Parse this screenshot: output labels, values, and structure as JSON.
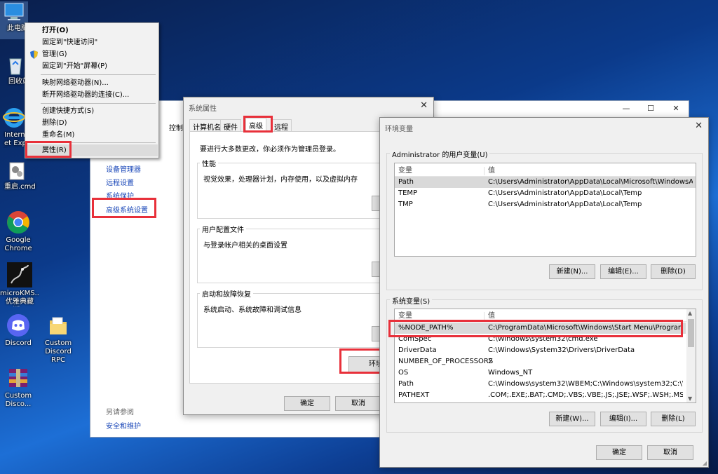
{
  "desktop_icons": [
    {
      "label": "此电脑",
      "icon": "computer-icon"
    },
    {
      "label": "回收站",
      "icon": "recycle-bin-icon"
    },
    {
      "label": "Internet Explorer",
      "icon": "ie-icon"
    },
    {
      "label": "重启.cmd",
      "icon": "cmd-file-icon"
    },
    {
      "label": "Google Chrome",
      "icon": "chrome-icon"
    },
    {
      "label": "microKMS...优雅典藏版...",
      "icon": "dragon-icon"
    },
    {
      "label": "Discord",
      "icon": "discord-icon"
    },
    {
      "label": "Custom Discord RPC",
      "icon": "folder-icon"
    },
    {
      "label": "Custom Disco...",
      "icon": "winrar-icon"
    }
  ],
  "context_menu": {
    "items": [
      {
        "label": "打开(O)",
        "bold": true
      },
      {
        "label": "固定到\"快速访问\""
      },
      {
        "label": "管理(G)",
        "icon": "shield-icon"
      },
      {
        "label": "固定到\"开始\"屏幕(P)"
      },
      {
        "label": "映射网络驱动器(N)..."
      },
      {
        "label": "断开网络驱动器的连接(C)..."
      },
      {
        "label": "创建快捷方式(S)"
      },
      {
        "label": "删除(D)"
      },
      {
        "label": "重命名(M)"
      },
      {
        "label": "属性(R)"
      }
    ]
  },
  "control_panel": {
    "breadcrumb_fragment": "控制",
    "side_links": [
      "设备管理器",
      "远程设置",
      "系统保护",
      "高级系统设置"
    ],
    "see_also": "另请参阅",
    "security_link": "安全和维护"
  },
  "system_properties": {
    "title": "系统属性",
    "tabs": [
      "计算机名",
      "硬件",
      "高级",
      "远程"
    ],
    "active_tab": "高级",
    "admin_note": "要进行大多数更改，你必须作为管理员登录。",
    "groups": [
      {
        "label": "性能",
        "desc": "视觉效果，处理器计划，内存使用，以及虚拟内存"
      },
      {
        "label": "用户配置文件",
        "desc": "与登录帐户相关的桌面设置"
      },
      {
        "label": "启动和故障恢复",
        "desc": "系统启动、系统故障和调试信息"
      }
    ],
    "env_button": "环境变",
    "ok": "确定",
    "cancel": "取消"
  },
  "env_vars": {
    "title": "环境变量",
    "user_section": "Administrator 的用户变量(U)",
    "system_section": "系统变量(S)",
    "col_var": "变量",
    "col_val": "值",
    "user_rows": [
      {
        "name": "Path",
        "value": "C:\\Users\\Administrator\\AppData\\Local\\Microsoft\\WindowsA..."
      },
      {
        "name": "TEMP",
        "value": "C:\\Users\\Administrator\\AppData\\Local\\Temp"
      },
      {
        "name": "TMP",
        "value": "C:\\Users\\Administrator\\AppData\\Local\\Temp"
      }
    ],
    "system_rows": [
      {
        "name": "%NODE_PATH%",
        "value": "C:\\ProgramData\\Microsoft\\Windows\\Start Menu\\Programs"
      },
      {
        "name": "ComSpec",
        "value": "C:\\Windows\\system32\\cmd.exe"
      },
      {
        "name": "DriverData",
        "value": "C:\\Windows\\System32\\Drivers\\DriverData"
      },
      {
        "name": "NUMBER_OF_PROCESSORS",
        "value": "2"
      },
      {
        "name": "OS",
        "value": "Windows_NT"
      },
      {
        "name": "Path",
        "value": "C:\\Windows\\system32\\WBEM;C:\\Windows\\system32;C:\\Wind..."
      },
      {
        "name": "PATHEXT",
        "value": ".COM;.EXE;.BAT;.CMD;.VBS;.VBE;.JS;.JSE;.WSF;.WSH;.MSC"
      }
    ],
    "user_new": "新建(N)...",
    "user_edit": "编辑(E)...",
    "user_delete": "删除(D)",
    "sys_new": "新建(W)...",
    "sys_edit": "编辑(I)...",
    "sys_delete": "删除(L)",
    "ok": "确定",
    "cancel": "取消"
  },
  "colors": {
    "highlight_red": "#e8303a",
    "link_blue": "#1a47b8"
  }
}
